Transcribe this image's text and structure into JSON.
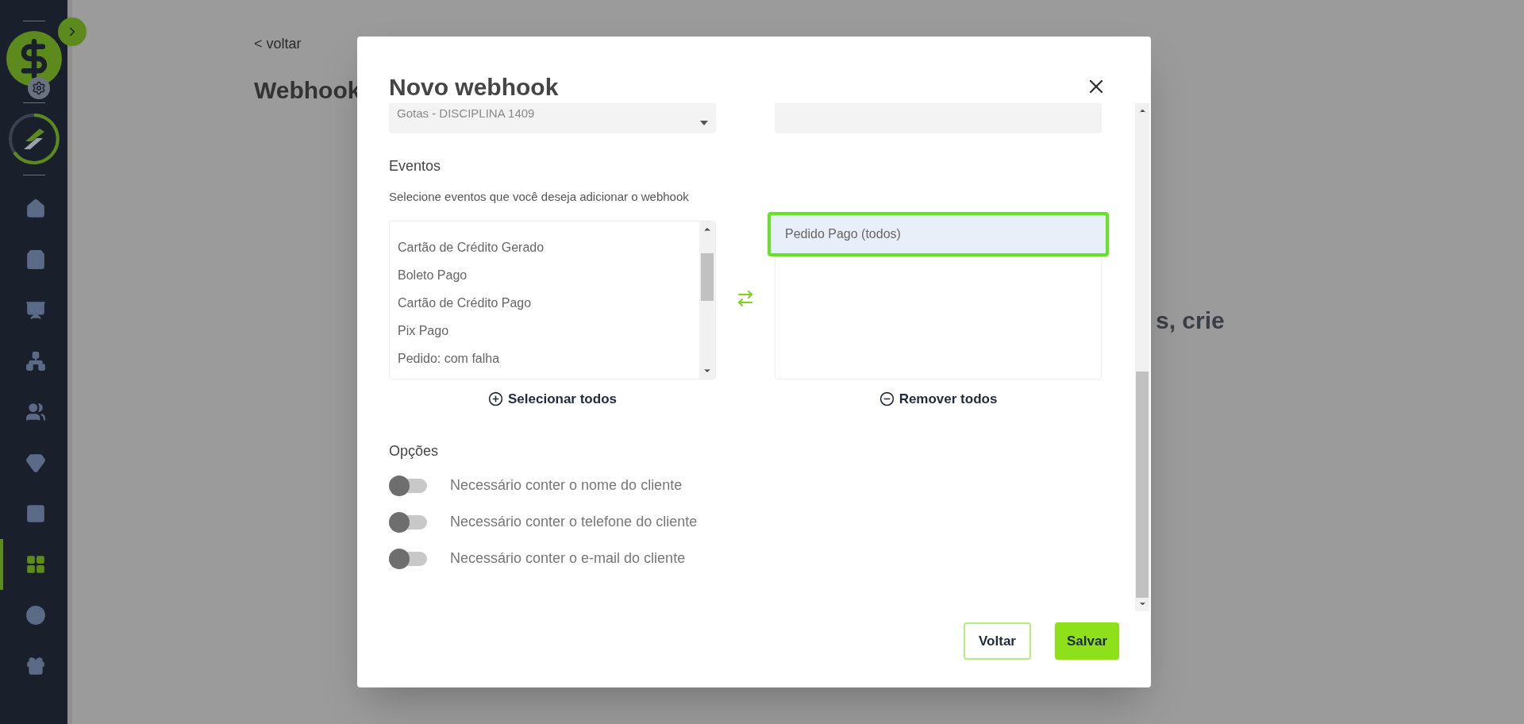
{
  "page": {
    "back_link": "< voltar",
    "title": "Webhook",
    "hero_text": "s, crie"
  },
  "sidebar": {
    "items": [
      {
        "selected": false
      },
      {
        "selected": false
      },
      {
        "selected": false
      },
      {
        "selected": false
      },
      {
        "selected": false
      },
      {
        "selected": false
      },
      {
        "selected": false
      },
      {
        "selected": true
      },
      {
        "selected": false
      },
      {
        "selected": false
      }
    ]
  },
  "modal": {
    "title": "Novo webhook",
    "product_select": {
      "value": "Gotas - DISCIPLINA 1409"
    },
    "events": {
      "heading": "Eventos",
      "description": "Selecione eventos que você deseja adicionar o webhook",
      "available": [
        "Cartão de Crédito Gerado",
        "Boleto Pago",
        "Cartão de Crédito Pago",
        "Pix Pago",
        "Pedido: com falha"
      ],
      "chosen": [
        {
          "label": "Pedido Pago (todos)",
          "selected": true
        }
      ],
      "select_all": "Selecionar todos",
      "remove_all": "Remover todos"
    },
    "options": {
      "heading": "Opções",
      "items": [
        {
          "label": "Necessário conter o nome do cliente",
          "on": false
        },
        {
          "label": "Necessário conter o telefone do cliente",
          "on": false
        },
        {
          "label": "Necessário conter o e-mail do cliente",
          "on": false
        }
      ]
    },
    "buttons": {
      "back": "Voltar",
      "save": "Salvar"
    }
  }
}
